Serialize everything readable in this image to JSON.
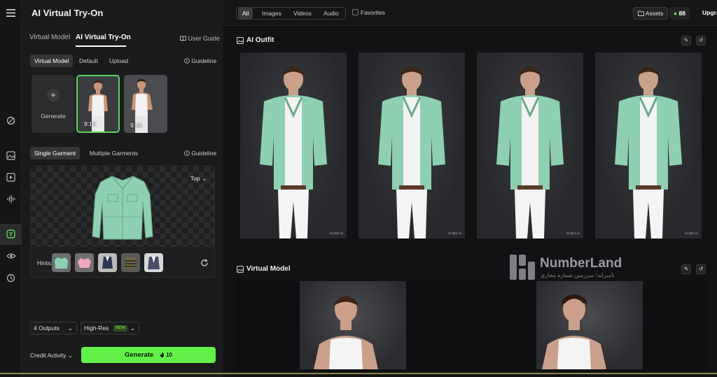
{
  "app": {
    "title": "AI Virtual Try-On"
  },
  "rail": {
    "icons": [
      "menu-icon",
      "magic-wand-icon",
      "image-icon",
      "video-icon",
      "audio-icon",
      "tryon-icon",
      "eye-icon",
      "history-icon"
    ]
  },
  "panel": {
    "tabs": [
      "Virtual Model",
      "AI Virtual Try-On"
    ],
    "user_guide": "User Guide",
    "model_tabs": [
      "Virtual Model",
      "Default",
      "Upload"
    ],
    "guideline": "Guideline",
    "generate_card": "Generate",
    "model_thumbs": [
      {
        "ratio": "9:16"
      },
      {
        "ratio": "9:16"
      }
    ],
    "garment_tabs": [
      "Single Garment",
      "Multiple Garments"
    ],
    "garment_type": "Top",
    "hints_label": "Hints:",
    "outputs": "4 Outputs",
    "quality": "High-Res",
    "new_badge": "NEW",
    "credit_activity": "Credit Activity",
    "generate_button": "Generate",
    "generate_cost": "10"
  },
  "topbar": {
    "filters": [
      "All",
      "Images",
      "Videos",
      "Audio"
    ],
    "favorites": "Favorites",
    "assets": "Assets",
    "credits": "88",
    "upgrade": "Upgra"
  },
  "sections": {
    "outfit_title": "AI Outfit",
    "model_title": "Virtual Model",
    "image_watermark": "KLING AI"
  },
  "watermark": {
    "name": "NumberLand",
    "subtitle": "نامبرلند؛ سرزمین شماره مجازی"
  },
  "colors": {
    "accent": "#62f04a",
    "jacket": "#8fcfb2"
  }
}
